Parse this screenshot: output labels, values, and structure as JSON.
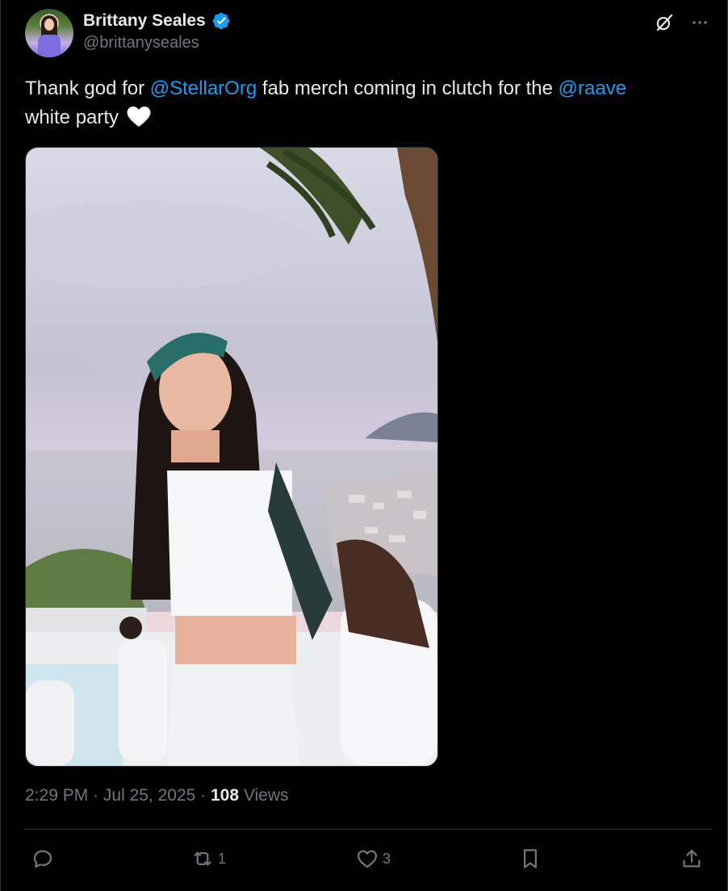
{
  "author": {
    "display_name": "Brittany Seales",
    "handle": "@brittanyseales",
    "verified": true,
    "verified_color": "#1d9bf0"
  },
  "header_icons": [
    "grok-icon",
    "more-icon"
  ],
  "tweet": {
    "text_1": "Thank god for ",
    "mention_1": "@StellarOrg",
    "text_2": " fab merch coming in clutch for the ",
    "mention_2": "@raave",
    "text_3": "white party",
    "emoji": "white-heart"
  },
  "meta": {
    "time": "2:29 PM",
    "sep1": " · ",
    "date": "Jul 25, 2025",
    "sep2": " · ",
    "views_count": "108",
    "views_label": " Views"
  },
  "actions": {
    "reply_count": "",
    "retweet_count": "1",
    "like_count": "3"
  },
  "colors": {
    "background": "#000000",
    "text": "#e7e9ea",
    "secondary": "#71767b",
    "link": "#1d9bf0",
    "border": "#2f3336"
  }
}
